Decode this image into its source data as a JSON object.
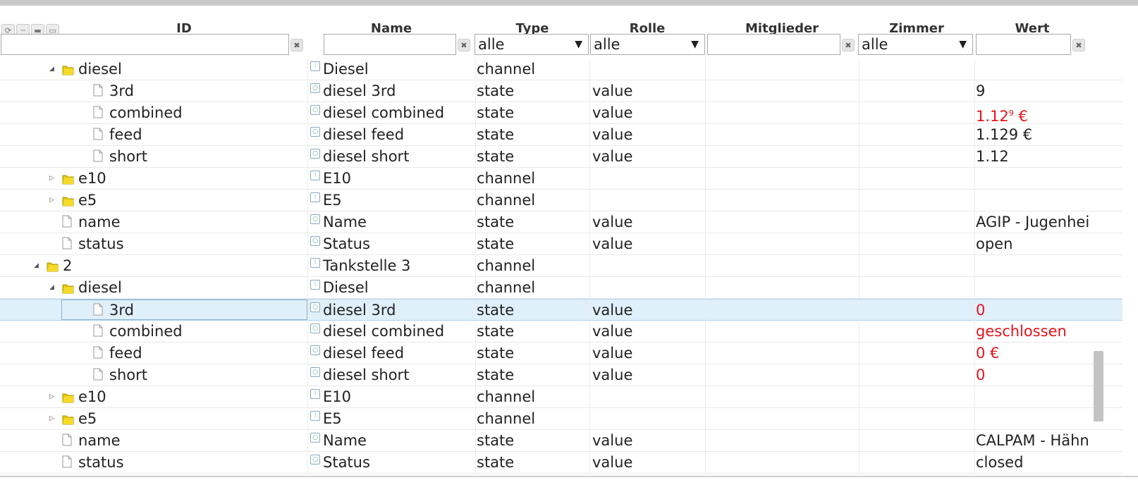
{
  "toolbar": {
    "icons": [
      "refresh-icon",
      "collapse-icon",
      "folder-closed-icon",
      "folder-open-icon"
    ]
  },
  "columns": {
    "id": "ID",
    "name": "Name",
    "type": "Type",
    "role": "Rolle",
    "members": "Mitglieder",
    "room": "Zimmer",
    "value": "Wert"
  },
  "filters": {
    "type_select": "alle",
    "role_select": "alle",
    "room_select": "alle",
    "clear_symbol": "✖"
  },
  "rows": [
    {
      "level": 2,
      "kind": "folder",
      "expanded": true,
      "id": "diesel",
      "name": "Diesel",
      "type": "channel",
      "role": "",
      "value": "",
      "value_red": false
    },
    {
      "level": 3,
      "kind": "file",
      "expanded": null,
      "id": "3rd",
      "name": "diesel 3rd",
      "type": "state",
      "role": "value",
      "value": "9",
      "value_red": false
    },
    {
      "level": 3,
      "kind": "file",
      "expanded": null,
      "id": "combined",
      "name": "diesel combined",
      "type": "state",
      "role": "value",
      "value": "1.12",
      "value_sup": "9",
      "value_suffix": " €",
      "value_red": true
    },
    {
      "level": 3,
      "kind": "file",
      "expanded": null,
      "id": "feed",
      "name": "diesel feed",
      "type": "state",
      "role": "value",
      "value": "1.129 €",
      "value_red": false
    },
    {
      "level": 3,
      "kind": "file",
      "expanded": null,
      "id": "short",
      "name": "diesel short",
      "type": "state",
      "role": "value",
      "value": "1.12",
      "value_red": false
    },
    {
      "level": 2,
      "kind": "folder",
      "expanded": false,
      "id": "e10",
      "name": "E10",
      "type": "channel",
      "role": "",
      "value": "",
      "value_red": false
    },
    {
      "level": 2,
      "kind": "folder",
      "expanded": false,
      "id": "e5",
      "name": "E5",
      "type": "channel",
      "role": "",
      "value": "",
      "value_red": false
    },
    {
      "level": 2,
      "kind": "file",
      "expanded": null,
      "id": "name",
      "name": "Name",
      "type": "state",
      "role": "value",
      "value": "AGIP - Jugenheim",
      "value_red": false
    },
    {
      "level": 2,
      "kind": "file",
      "expanded": null,
      "id": "status",
      "name": "Status",
      "type": "state",
      "role": "value",
      "value": "open",
      "value_red": false
    },
    {
      "level": 1,
      "kind": "folder",
      "expanded": true,
      "id": "2",
      "name": "Tankstelle 3",
      "type": "channel",
      "role": "",
      "value": "",
      "value_red": false
    },
    {
      "level": 2,
      "kind": "folder",
      "expanded": true,
      "id": "diesel",
      "name": "Diesel",
      "type": "channel",
      "role": "",
      "value": "",
      "value_red": false
    },
    {
      "level": 3,
      "kind": "file",
      "expanded": null,
      "id": "3rd",
      "name": "diesel 3rd",
      "type": "state",
      "role": "value",
      "value": "0",
      "value_red": true,
      "selected": true
    },
    {
      "level": 3,
      "kind": "file",
      "expanded": null,
      "id": "combined",
      "name": "diesel combined",
      "type": "state",
      "role": "value",
      "value": "geschlossen",
      "value_red": true
    },
    {
      "level": 3,
      "kind": "file",
      "expanded": null,
      "id": "feed",
      "name": "diesel feed",
      "type": "state",
      "role": "value",
      "value": "0 €",
      "value_red": true
    },
    {
      "level": 3,
      "kind": "file",
      "expanded": null,
      "id": "short",
      "name": "diesel short",
      "type": "state",
      "role": "value",
      "value": "0",
      "value_red": true
    },
    {
      "level": 2,
      "kind": "folder",
      "expanded": false,
      "id": "e10",
      "name": "E10",
      "type": "channel",
      "role": "",
      "value": "",
      "value_red": false
    },
    {
      "level": 2,
      "kind": "folder",
      "expanded": false,
      "id": "e5",
      "name": "E5",
      "type": "channel",
      "role": "",
      "value": "",
      "value_red": false
    },
    {
      "level": 2,
      "kind": "file",
      "expanded": null,
      "id": "name",
      "name": "Name",
      "type": "state",
      "role": "value",
      "value": "CALPAM - Hähnlein",
      "value_red": false
    },
    {
      "level": 2,
      "kind": "file",
      "expanded": null,
      "id": "status",
      "name": "Status",
      "type": "state",
      "role": "value",
      "value": "closed",
      "value_red": false
    }
  ],
  "colors": {
    "value_alert": "#e8121a",
    "selected_row": "#dff0fb",
    "folder": "#e6c200"
  }
}
